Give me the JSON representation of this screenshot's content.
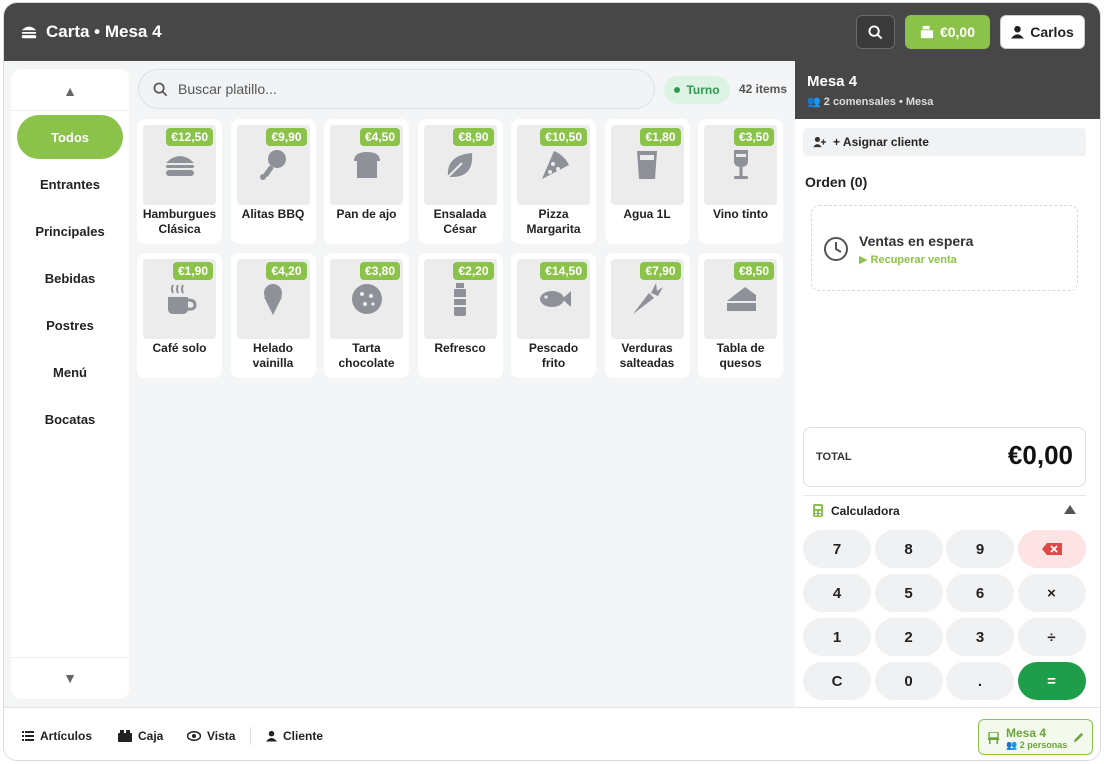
{
  "header": {
    "title": "Carta • Mesa 4",
    "title_icon": "burger-icon",
    "search_icon": "search-icon",
    "cart_total": "€0,00",
    "cart_icon": "register-icon",
    "user_name": "Carlos",
    "user_icon": "user-icon"
  },
  "sidebar": {
    "up_arrow": "▲",
    "down_arrow": "▼",
    "categories": [
      {
        "label": "Todos",
        "active": true
      },
      {
        "label": "Entrantes"
      },
      {
        "label": "Principales"
      },
      {
        "label": "Bebidas"
      },
      {
        "label": "Postres"
      },
      {
        "label": "Menú"
      },
      {
        "label": "Bocatas"
      }
    ]
  },
  "search": {
    "placeholder": "Buscar platillo...",
    "turno_label": "Turno",
    "items_count": "42 items"
  },
  "products": [
    {
      "line1": "Hamburgues",
      "line2": "Clásica",
      "price": "€12,50",
      "icon": "burger"
    },
    {
      "line1": "Alitas BBQ",
      "line2": "",
      "price": "€9,90",
      "icon": "drumstick"
    },
    {
      "line1": "Pan de ajo",
      "line2": "",
      "price": "€4,50",
      "icon": "bread"
    },
    {
      "line1": "Ensalada",
      "line2": "César",
      "price": "€8,90",
      "icon": "leaf"
    },
    {
      "line1": "Pizza",
      "line2": "Margarita",
      "price": "€10,50",
      "icon": "pizza"
    },
    {
      "line1": "Agua 1L",
      "line2": "",
      "price": "€1,80",
      "icon": "glass"
    },
    {
      "line1": "Vino tinto",
      "line2": "",
      "price": "€3,50",
      "icon": "wine"
    },
    {
      "line1": "Café solo",
      "line2": "",
      "price": "€1,90",
      "icon": "coffee"
    },
    {
      "line1": "Helado",
      "line2": "vainilla",
      "price": "€4,20",
      "icon": "icecream"
    },
    {
      "line1": "Tarta",
      "line2": "chocolate",
      "price": "€3,80",
      "icon": "cookie"
    },
    {
      "line1": "Refresco",
      "line2": "",
      "price": "€2,20",
      "icon": "bottle"
    },
    {
      "line1": "Pescado",
      "line2": "frito",
      "price": "€14,50",
      "icon": "fish"
    },
    {
      "line1": "Verduras",
      "line2": "salteadas",
      "price": "€7,90",
      "icon": "carrot"
    },
    {
      "line1": "Tabla de",
      "line2": "quesos",
      "price": "€8,50",
      "icon": "cheese"
    }
  ],
  "order": {
    "mesa_title": "Mesa 4",
    "mesa_subtitle": "2 comensales • Mesa",
    "assign_client": "+ Asignar cliente",
    "orden_label": "Orden (0)",
    "espera_title": "Ventas en espera",
    "espera_action": "▶ Recuperar venta",
    "total_label": "TOTAL",
    "total_value": "€0,00",
    "calc_label": "Calculadora",
    "keys": [
      "7",
      "8",
      "9",
      "⌫",
      "4",
      "5",
      "6",
      "×",
      "1",
      "2",
      "3",
      "÷",
      "C",
      "0",
      ".",
      "="
    ]
  },
  "bottom": {
    "articulos": "Artículos",
    "caja": "Caja",
    "vista": "Vista",
    "cliente": "Cliente",
    "mesa_chip_title": "Mesa 4",
    "mesa_chip_sub": "2 personas"
  },
  "colors": {
    "accent_green": "#8bc34a",
    "confirm_green": "#1e9e4a",
    "header_dark": "#474747"
  }
}
